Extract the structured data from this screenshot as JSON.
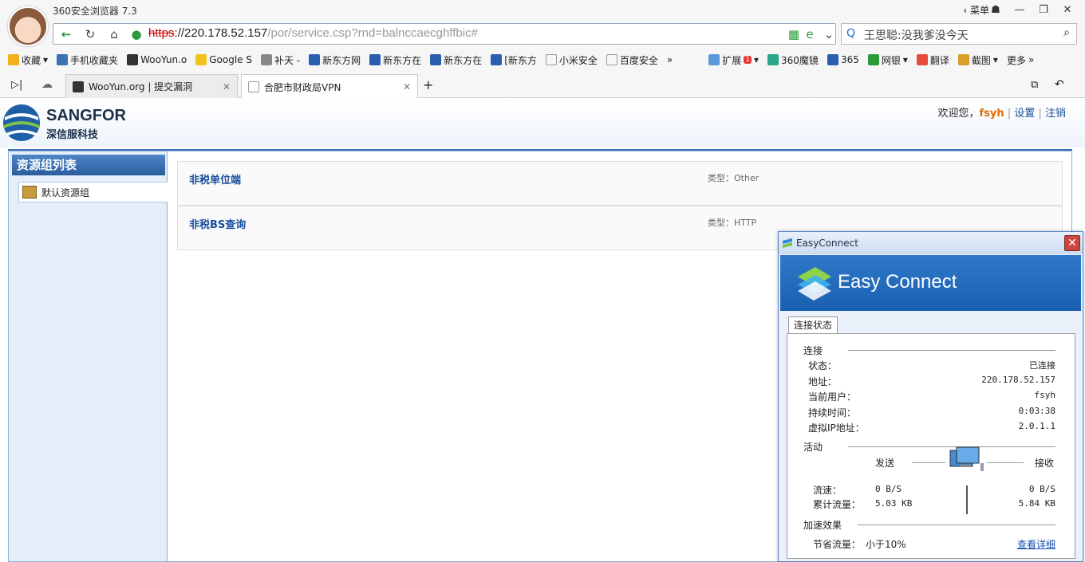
{
  "browser": {
    "title": "360安全浏览器 7.3",
    "menu_label": "菜单",
    "url_proto": "https",
    "url_host": "://220.178.52.157",
    "url_path": "/por/service.csp?rnd=balnccaecghffbic#",
    "search_text": "王思聪:没我爹没今天",
    "bookmarks": [
      "收藏",
      "手机收藏夹",
      "WooYun.o",
      "Google S",
      "补天 -",
      "新东方网",
      "新东方在",
      "新东方在",
      "[新东方",
      "小米安全",
      "百度安全"
    ],
    "tools": [
      "扩展",
      "360魔镜",
      "365",
      "网银",
      "翻译",
      "截图",
      "更多"
    ],
    "ext_badge": "1",
    "tabs": [
      {
        "label": "WooYun.org | 提交漏洞"
      },
      {
        "label": "合肥市财政局VPN"
      }
    ]
  },
  "header": {
    "brand": "SANGFOR",
    "brand_sub": "深信服科技",
    "welcome": "欢迎您，",
    "user": "fsyh",
    "sep": "|",
    "settings": "设置",
    "logout": "注销"
  },
  "sidebar": {
    "title": "资源组列表",
    "item": "默认资源组"
  },
  "resources": [
    {
      "name": "非税单位端",
      "type": "类型：Other"
    },
    {
      "name": "非税BS查询",
      "type": "类型：HTTP"
    }
  ],
  "easyconnect": {
    "window_title": "EasyConnect",
    "brand": "Easy Connect",
    "tab": "连接状态",
    "conn_section": "连接",
    "rows": [
      {
        "k": "状态：",
        "v": "已连接"
      },
      {
        "k": "地址：",
        "v": "220.178.52.157"
      },
      {
        "k": "当前用户：",
        "v": "fsyh"
      },
      {
        "k": "持续时间：",
        "v": "0:03:38"
      },
      {
        "k": "虚拟IP地址：",
        "v": "2.0.1.1"
      }
    ],
    "activity_section": "活动",
    "send": "发送",
    "recv": "接收",
    "rate_label": "流速：",
    "rate_send": "0 B/S",
    "rate_recv": "0 B/S",
    "total_label": "累计流量：",
    "total_send": "5.03 KB",
    "total_recv": "5.84 KB",
    "accel_section": "加速效果",
    "saved_label": "节省流量：",
    "saved_value": "小于10%",
    "details_link": "查看详细"
  },
  "colors": {
    "accent": "#3a72b5",
    "link": "#1a4f9c",
    "user": "#e06a00"
  }
}
